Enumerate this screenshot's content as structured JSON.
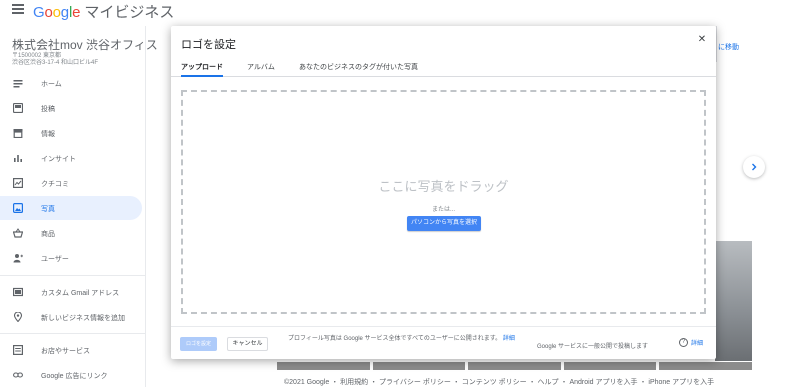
{
  "header": {
    "brand_google": "Google",
    "brand_product": "マイビジネス"
  },
  "business": {
    "name": "株式会社mov 渋谷オフィス",
    "address_line1": "〒1500002 東京都",
    "address_line2": "渋谷区渋谷3-17-4 和山口ビル4F"
  },
  "sidebar": {
    "items": [
      {
        "label": "ホーム",
        "icon": "home-icon"
      },
      {
        "label": "投稿",
        "icon": "post-icon"
      },
      {
        "label": "情報",
        "icon": "store-icon"
      },
      {
        "label": "インサイト",
        "icon": "bar-chart-icon"
      },
      {
        "label": "クチコミ",
        "icon": "review-icon"
      },
      {
        "label": "写真",
        "icon": "photo-icon"
      },
      {
        "label": "商品",
        "icon": "basket-icon"
      },
      {
        "label": "ユーザー",
        "icon": "add-user-icon"
      },
      {
        "label": "カスタム Gmail アドレス",
        "icon": "mail-icon"
      },
      {
        "label": "新しいビジネス情報を追加",
        "icon": "location-icon"
      },
      {
        "label": "お店やサービス",
        "icon": "list-icon"
      },
      {
        "label": "Google 広告にリンク",
        "icon": "link-icon"
      }
    ],
    "active_index": 5
  },
  "background": {
    "link_fragment": "に移動"
  },
  "dialog": {
    "title": "ロゴを設定",
    "close_icon": "close-icon",
    "tabs": [
      "アップロード",
      "アルバム",
      "あなたのビジネスのタグが付いた写真"
    ],
    "active_tab": 0,
    "drop_title": "ここに写真をドラッグ",
    "drop_or": "または...",
    "upload_button": "パソコンから写真を選択",
    "set_logo_button": "ロゴを設定",
    "cancel_button": "キャンセル",
    "footer_note": "プロフィール写真は Google サービス全体ですべてのユーザーに公開されます。",
    "footer_note_link": "詳細",
    "footer_public": "Google サービスに一般公開で投稿します",
    "help_link": "詳細",
    "help_icon": "help-icon"
  },
  "footer": {
    "text": "©2021 Google ・ 利用規約 ・ プライバシー ポリシー ・ コンテンツ ポリシー ・ ヘルプ ・ Android アプリを入手 ・ iPhone アプリを入手"
  },
  "colors": {
    "accent": "#1a73e8",
    "button_primary": "#4285f4",
    "button_disabled": "#aecbfa",
    "active_nav_bg": "#e8f0fe"
  }
}
